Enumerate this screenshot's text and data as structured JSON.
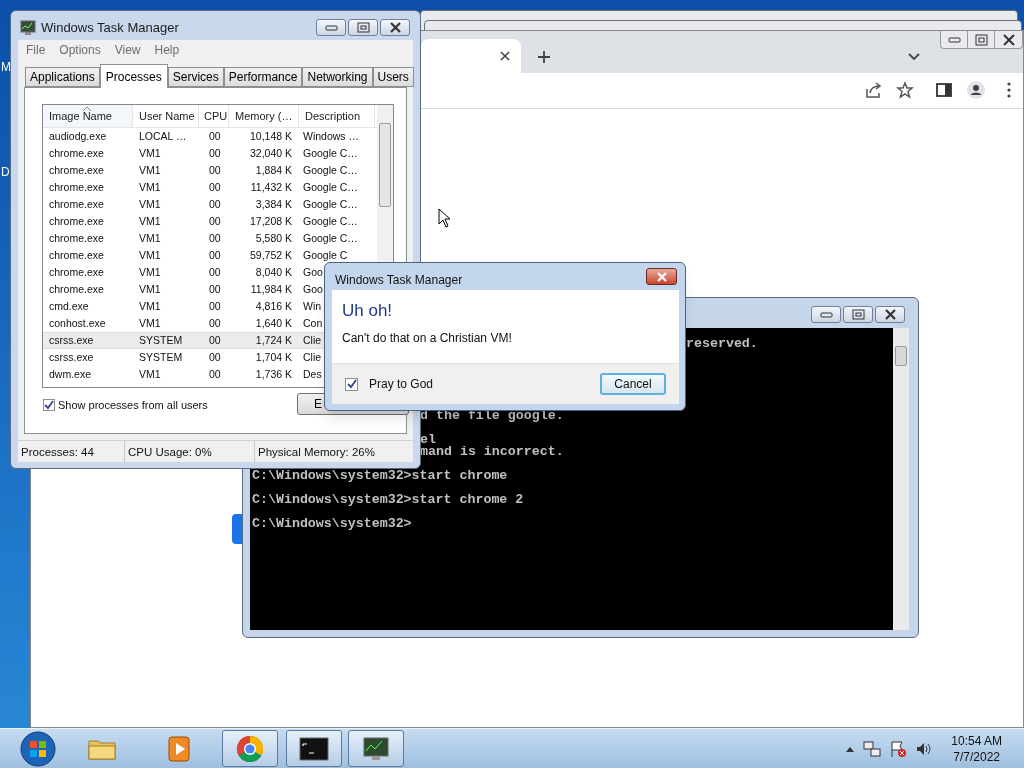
{
  "desktop": {
    "icon_labels": [
      "M",
      "D"
    ]
  },
  "task_manager": {
    "title": "Windows Task Manager",
    "menu": [
      "File",
      "Options",
      "View",
      "Help"
    ],
    "tabs": [
      {
        "label": "Applications",
        "selected": false
      },
      {
        "label": "Processes",
        "selected": true
      },
      {
        "label": "Services",
        "selected": false
      },
      {
        "label": "Performance",
        "selected": false
      },
      {
        "label": "Networking",
        "selected": false
      },
      {
        "label": "Users",
        "selected": false
      }
    ],
    "columns": [
      {
        "label": "Image Name",
        "sorted": true
      },
      {
        "label": "User Name",
        "sorted": false
      },
      {
        "label": "CPU",
        "sorted": false
      },
      {
        "label": "Memory (…",
        "sorted": false
      },
      {
        "label": "Description",
        "sorted": false
      }
    ],
    "rows": [
      {
        "cells": [
          "audiodg.exe",
          "LOCAL …",
          "00",
          "10,148 K",
          "Windows …"
        ],
        "selected": false
      },
      {
        "cells": [
          "chrome.exe",
          "VM1",
          "00",
          "32,040 K",
          "Google C…"
        ],
        "selected": false
      },
      {
        "cells": [
          "chrome.exe",
          "VM1",
          "00",
          "1,884 K",
          "Google C…"
        ],
        "selected": false
      },
      {
        "cells": [
          "chrome.exe",
          "VM1",
          "00",
          "11,432 K",
          "Google C…"
        ],
        "selected": false
      },
      {
        "cells": [
          "chrome.exe",
          "VM1",
          "00",
          "3,384 K",
          "Google C…"
        ],
        "selected": false
      },
      {
        "cells": [
          "chrome.exe",
          "VM1",
          "00",
          "17,208 K",
          "Google C…"
        ],
        "selected": false
      },
      {
        "cells": [
          "chrome.exe",
          "VM1",
          "00",
          "5,580 K",
          "Google C…"
        ],
        "selected": false
      },
      {
        "cells": [
          "chrome.exe",
          "VM1",
          "00",
          "59,752 K",
          "Google C"
        ],
        "selected": false
      },
      {
        "cells": [
          "chrome.exe",
          "VM1",
          "00",
          "8,040 K",
          "Goo"
        ],
        "selected": false
      },
      {
        "cells": [
          "chrome.exe",
          "VM1",
          "00",
          "11,984 K",
          "Goo"
        ],
        "selected": false
      },
      {
        "cells": [
          "cmd.exe",
          "VM1",
          "00",
          "4,816 K",
          "Win"
        ],
        "selected": false
      },
      {
        "cells": [
          "conhost.exe",
          "VM1",
          "00",
          "1,640 K",
          "Con"
        ],
        "selected": false
      },
      {
        "cells": [
          "csrss.exe",
          "SYSTEM",
          "00",
          "1,724 K",
          "Clie"
        ],
        "selected": true
      },
      {
        "cells": [
          "csrss.exe",
          "SYSTEM",
          "00",
          "1,704 K",
          "Clie"
        ],
        "selected": false
      },
      {
        "cells": [
          "dwm.exe",
          "VM1",
          "00",
          "1,736 K",
          "Des"
        ],
        "selected": false
      }
    ],
    "show_all_users": {
      "label": "Show processes from all users",
      "checked": true
    },
    "end_button": "E",
    "status": [
      "Processes: 44",
      "CPU Usage: 0%",
      "Physical Memory: 26%"
    ]
  },
  "dialog": {
    "title": "Windows Task Manager",
    "heading": "Uh oh!",
    "message": "Can't do that on a Christian VM!",
    "checkbox": {
      "label": "Pray to God",
      "checked": true
    },
    "button": "Cancel"
  },
  "console": {
    "lines": [
      "reserved.",
      "d the file google.",
      "el",
      "mand is incorrect.",
      "C:\\Windows\\system32>start chrome",
      "C:\\Windows\\system32>start chrome 2",
      "C:\\Windows\\system32>"
    ]
  },
  "taskbar": {
    "items": [
      {
        "kind": "explorer",
        "running": false
      },
      {
        "kind": "media",
        "running": false
      },
      {
        "kind": "chrome",
        "running": true
      },
      {
        "kind": "console",
        "running": true
      },
      {
        "kind": "taskmgr",
        "running": true
      }
    ],
    "clock": {
      "time": "10:54 AM",
      "date": "7/7/2022"
    }
  }
}
